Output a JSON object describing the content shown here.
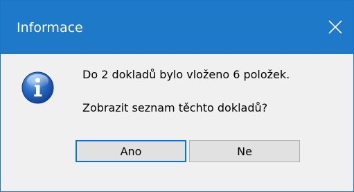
{
  "window": {
    "title": "Informace",
    "close_icon": "close-icon"
  },
  "message": {
    "icon": "info-icon",
    "line1": "Do 2 dokladů bylo vloženo 6 položek.",
    "line2": "Zobrazit seznam těchto dokladů?"
  },
  "buttons": {
    "yes_label": "Ano",
    "no_label": "Ne"
  },
  "colors": {
    "titlebar": "#1e79c9",
    "body": "#f0f0f0",
    "focus_border": "#0078d7"
  }
}
